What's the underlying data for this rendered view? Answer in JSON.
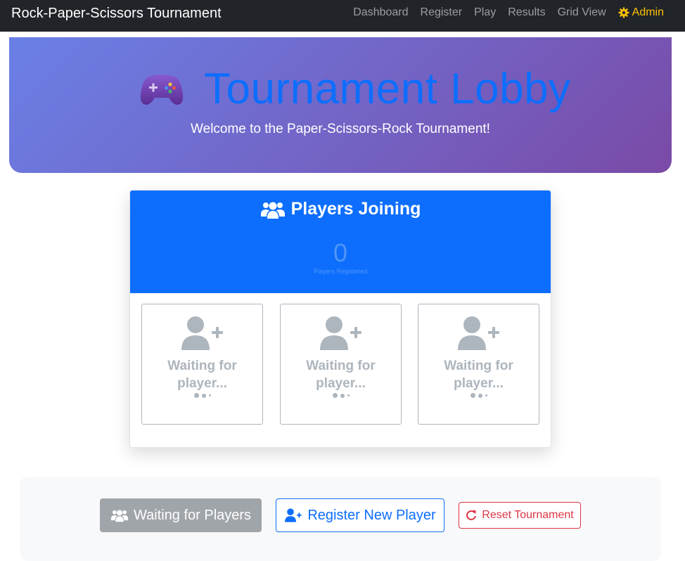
{
  "navbar": {
    "brand": "Rock-Paper-Scissors Tournament",
    "links": [
      "Dashboard",
      "Register",
      "Play",
      "Results",
      "Grid View"
    ],
    "admin_label": "Admin"
  },
  "hero": {
    "title": "Tournament Lobby",
    "subtitle": "Welcome to the Paper-Scissors-Rock Tournament!",
    "icon": "gamepad-icon"
  },
  "card": {
    "title": "Players Joining",
    "count": "0",
    "count_label": "Players Registered",
    "slots": [
      {
        "label": "Waiting for player..."
      },
      {
        "label": "Waiting for player..."
      },
      {
        "label": "Waiting for player..."
      }
    ]
  },
  "actions": {
    "waiting_label": "Waiting for Players",
    "register_label": "Register New Player",
    "reset_label": "Reset Tournament"
  },
  "colors": {
    "navbar": "#212529",
    "primary": "#0d6efd",
    "admin": "#ffc107",
    "danger": "#dc3545",
    "muted": "#adb5bd"
  }
}
